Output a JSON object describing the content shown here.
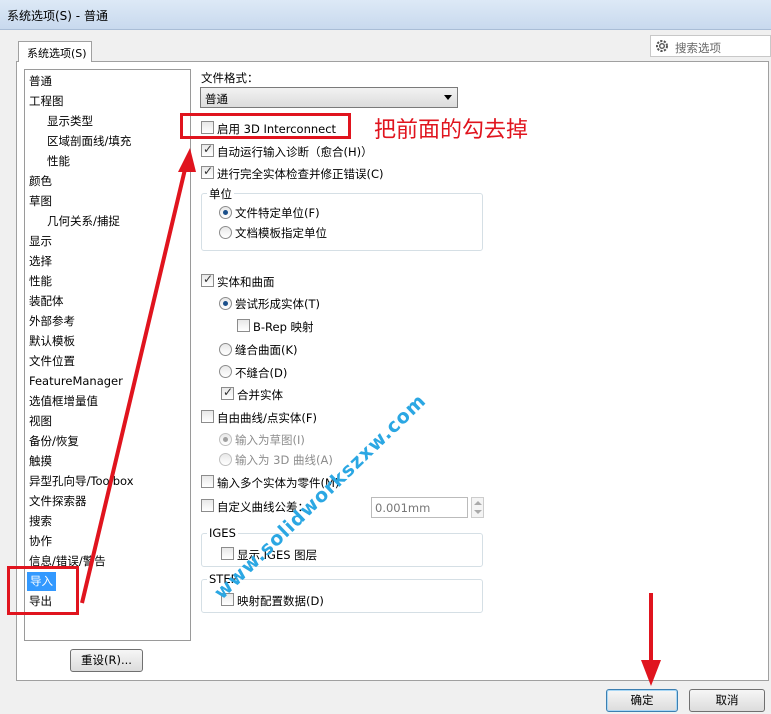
{
  "window": {
    "title": "系统选项(S) - 普通"
  },
  "tab": {
    "label": "系统选项(S)"
  },
  "search": {
    "placeholder": "搜索选项"
  },
  "nav": {
    "items": [
      {
        "label": "普通"
      },
      {
        "label": "工程图"
      },
      {
        "label": "显示类型"
      },
      {
        "label": "区域剖面线/填充"
      },
      {
        "label": "性能"
      },
      {
        "label": "颜色"
      },
      {
        "label": "草图"
      },
      {
        "label": "几何关系/捕捉"
      },
      {
        "label": "显示"
      },
      {
        "label": "选择"
      },
      {
        "label": "性能"
      },
      {
        "label": "装配体"
      },
      {
        "label": "外部参考"
      },
      {
        "label": "默认模板"
      },
      {
        "label": "文件位置"
      },
      {
        "label": "FeatureManager"
      },
      {
        "label": "选值框增量值"
      },
      {
        "label": "视图"
      },
      {
        "label": "备份/恢复"
      },
      {
        "label": "触摸"
      },
      {
        "label": "异型孔向导/Toolbox"
      },
      {
        "label": "文件探索器"
      },
      {
        "label": "搜索"
      },
      {
        "label": "协作"
      },
      {
        "label": "信息/错误/警告"
      },
      {
        "label": "导入"
      },
      {
        "label": "导出"
      }
    ],
    "selected": "导入"
  },
  "content": {
    "file_format_label": "文件格式：",
    "file_format_value": "普通",
    "enable_3d_interconnect": "启用 3D Interconnect",
    "auto_diagnose": "自动运行输入诊断（愈合(H)）",
    "full_check": "进行完全实体检查并修正错误(C)",
    "unit_group": {
      "title": "单位",
      "opt_file_units": "文件特定单位(F)",
      "opt_template_units": "文档模板指定单位"
    },
    "solid_surface": {
      "label": "实体和曲面",
      "try_solid": "尝试形成实体(T)",
      "brep": "B-Rep 映射",
      "knit": "缝合曲面(K)",
      "no_knit": "不缝合(D)",
      "merge": "合并实体"
    },
    "free_curves": {
      "label": "自由曲线/点实体(F)",
      "as_sketch": "输入为草图(I)",
      "as_3d_curve": "输入为 3D 曲线(A)"
    },
    "multi_body": "输入多个实体为零件(M)",
    "custom_tol_label": "自定义曲线公差：",
    "custom_tol_value": "0.001mm",
    "iges": {
      "title": "IGES",
      "show_layers": "显示 IGES 图层"
    },
    "step": {
      "title": "STEP",
      "map_config": "映射配置数据(D)"
    }
  },
  "buttons": {
    "reset": "重设(R)...",
    "ok": "确定",
    "cancel": "取消"
  },
  "annotation": {
    "text": "把前面的勾去掉"
  },
  "watermark": {
    "text": "www.solidworkszxw.com"
  },
  "colors": {
    "highlight_red": "#e0141e",
    "selection_blue": "#3399ff",
    "watermark_blue": "#2ba7e3"
  },
  "state": {
    "enable_3d_interconnect": false,
    "auto_diagnose": true,
    "full_check": true,
    "unit": "file",
    "solid_surface": true,
    "solid_mode": "try_solid",
    "brep": false,
    "merge": true,
    "free_curves": false,
    "multi_body": false,
    "custom_tol": false,
    "iges_layers": false,
    "step_map": false
  }
}
